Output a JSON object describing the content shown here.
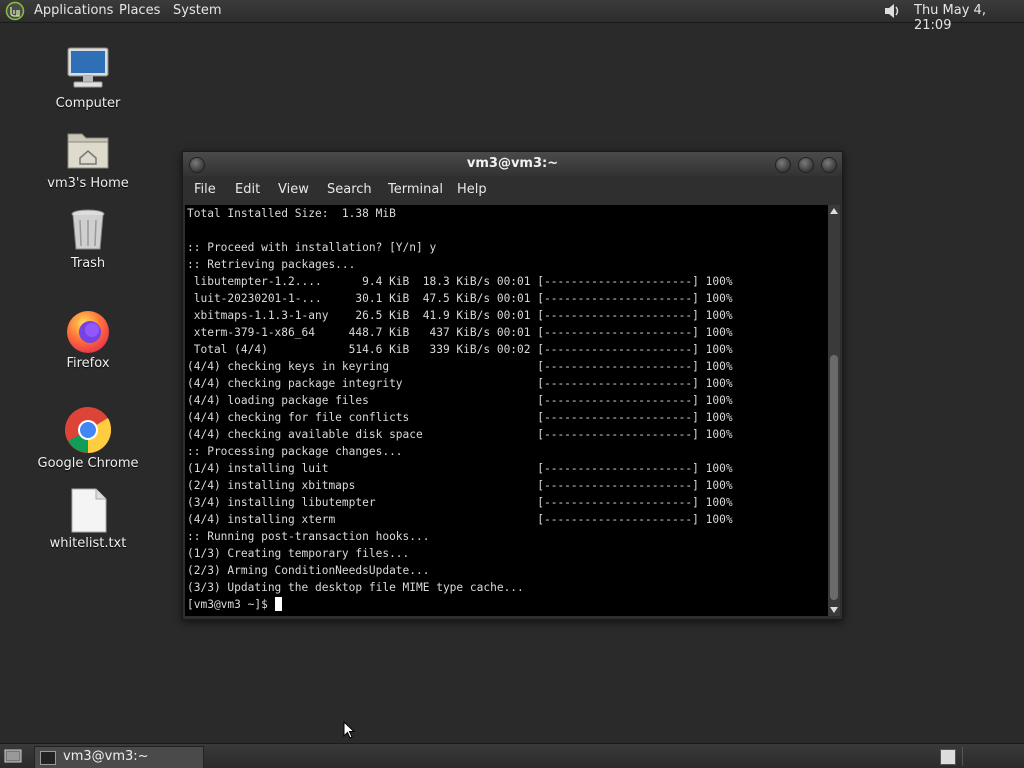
{
  "top_panel": {
    "menus": [
      "Applications",
      "Places",
      "System"
    ],
    "clock": "Thu May  4, 21:09"
  },
  "desktop_icons": [
    {
      "label": "Computer",
      "icon": "computer-icon"
    },
    {
      "label": "vm3's Home",
      "icon": "home-folder-icon"
    },
    {
      "label": "Trash",
      "icon": "trash-icon"
    },
    {
      "label": "Firefox",
      "icon": "firefox-icon"
    },
    {
      "label": "Google Chrome",
      "icon": "chrome-icon"
    },
    {
      "label": "whitelist.txt",
      "icon": "text-file-icon"
    }
  ],
  "window": {
    "title": "vm3@vm3:~",
    "menu": [
      "File",
      "Edit",
      "View",
      "Search",
      "Terminal",
      "Help"
    ],
    "lines": [
      "Total Installed Size:  1.38 MiB",
      "",
      ":: Proceed with installation? [Y/n] y",
      ":: Retrieving packages...",
      " libutempter-1.2....      9.4 KiB  18.3 KiB/s 00:01 [----------------------] 100%",
      " luit-20230201-1-...     30.1 KiB  47.5 KiB/s 00:01 [----------------------] 100%",
      " xbitmaps-1.1.3-1-any    26.5 KiB  41.9 KiB/s 00:01 [----------------------] 100%",
      " xterm-379-1-x86_64     448.7 KiB   437 KiB/s 00:01 [----------------------] 100%",
      " Total (4/4)            514.6 KiB   339 KiB/s 00:02 [----------------------] 100%",
      "(4/4) checking keys in keyring                      [----------------------] 100%",
      "(4/4) checking package integrity                    [----------------------] 100%",
      "(4/4) loading package files                         [----------------------] 100%",
      "(4/4) checking for file conflicts                   [----------------------] 100%",
      "(4/4) checking available disk space                 [----------------------] 100%",
      ":: Processing package changes...",
      "(1/4) installing luit                               [----------------------] 100%",
      "(2/4) installing xbitmaps                           [----------------------] 100%",
      "(3/4) installing libutempter                        [----------------------] 100%",
      "(4/4) installing xterm                              [----------------------] 100%",
      ":: Running post-transaction hooks...",
      "(1/3) Creating temporary files...",
      "(2/3) Arming ConditionNeedsUpdate...",
      "(3/3) Updating the desktop file MIME type cache..."
    ],
    "prompt": "[vm3@vm3 ~]$ "
  },
  "taskbar": {
    "task_label": "vm3@vm3:~"
  }
}
